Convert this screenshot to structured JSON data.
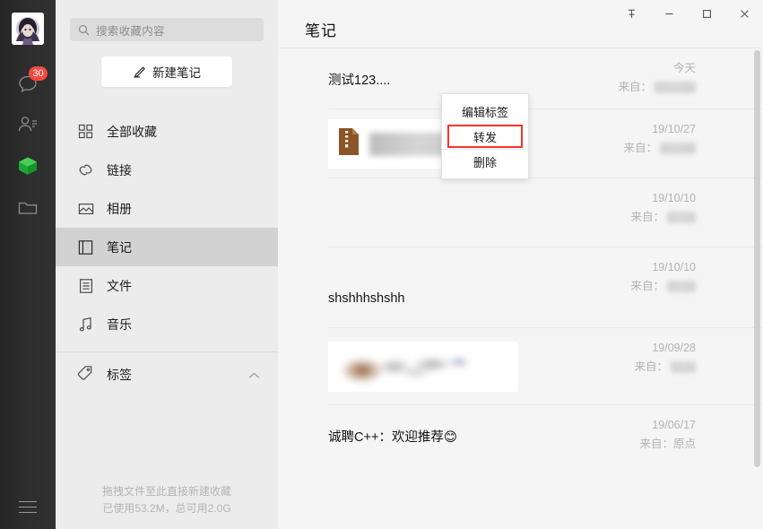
{
  "rail": {
    "avatar_name": "user-avatar",
    "items": [
      {
        "icon": "chat-icon",
        "badge": "30"
      },
      {
        "icon": "contacts-icon",
        "badge": ""
      },
      {
        "icon": "favorites-cube-icon",
        "badge": ""
      },
      {
        "icon": "folder-icon",
        "badge": ""
      }
    ],
    "menu_icon": "hamburger-menu-icon",
    "accent_green": "#2bbd3e",
    "badge_color": "#f5493f"
  },
  "sidebar": {
    "search": {
      "placeholder": "搜索收藏内容",
      "value": "",
      "icon": "search-icon"
    },
    "new_note": {
      "label": "新建笔记",
      "icon": "pencil-icon"
    },
    "nav": [
      {
        "label": "全部收藏",
        "icon": "grid-icon",
        "active": false
      },
      {
        "label": "链接",
        "icon": "link-icon",
        "active": false
      },
      {
        "label": "相册",
        "icon": "image-icon",
        "active": false
      },
      {
        "label": "笔记",
        "icon": "notebook-icon",
        "active": true
      },
      {
        "label": "文件",
        "icon": "document-icon",
        "active": false
      },
      {
        "label": "音乐",
        "icon": "music-note-icon",
        "active": false
      }
    ],
    "tag_section": {
      "label": "标签",
      "icon": "tag-icon",
      "chevron": "chevron-up-icon"
    },
    "footer": {
      "hint": "拖拽文件至此直接新建收藏",
      "storage": "已使用53.2M，总可用2.0G"
    }
  },
  "titlebar": {
    "title": "笔记",
    "controls": [
      {
        "name": "pin-icon",
        "label": ""
      },
      {
        "name": "minimize-icon",
        "label": ""
      },
      {
        "name": "maximize-icon",
        "label": ""
      },
      {
        "name": "close-icon",
        "label": ""
      }
    ]
  },
  "list": {
    "from_label": "来自：",
    "rows": [
      {
        "kind": "text",
        "title": "测试123....",
        "date": "今天",
        "from_label": "来自：",
        "from_blur_w": 46
      },
      {
        "kind": "file",
        "title": "",
        "date": "19/10/27",
        "from_label": "来自：",
        "from_blur_w": 40
      },
      {
        "kind": "empty",
        "title": "",
        "date": "19/10/10",
        "from_label": "来自：",
        "from_blur_w": 32
      },
      {
        "kind": "text",
        "title": "shshhhshshh",
        "date": "19/10/10",
        "from_label": "来自：",
        "from_blur_w": 32
      },
      {
        "kind": "image",
        "title": "",
        "date": "19/09/28",
        "from_label": "来自：",
        "from_blur_w": 28
      },
      {
        "kind": "text",
        "title": "诚聘C++：欢迎推荐😊",
        "date": "19/06/17",
        "from_label": "来自：原点",
        "from_blur_w": 0
      }
    ]
  },
  "context_menu": {
    "items": [
      {
        "label": "编辑标签",
        "highlighted": false
      },
      {
        "label": "转发",
        "highlighted": true
      },
      {
        "label": "删除",
        "highlighted": false
      }
    ],
    "highlight_color": "#f4352c"
  },
  "scrollbar": {
    "name": "vertical-scrollbar"
  }
}
